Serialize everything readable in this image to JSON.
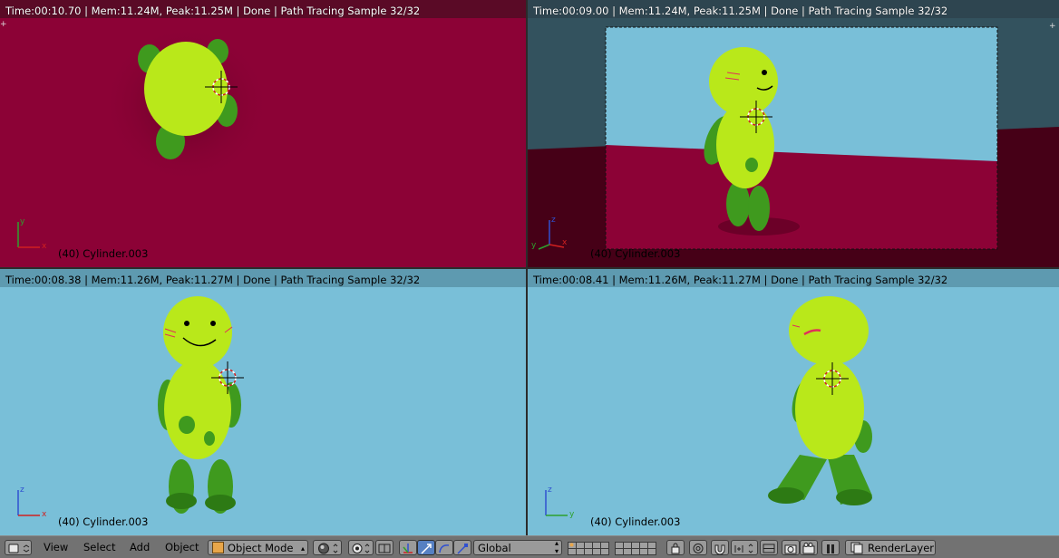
{
  "viewports": [
    {
      "id": "top-left",
      "render_info": "Time:00:10.70 | Mem:11.24M, Peak:11.25M | Done | Path Tracing Sample 32/32",
      "object_name": "(40) Cylinder.003",
      "axes": [
        "y",
        "x"
      ]
    },
    {
      "id": "top-right",
      "render_info": "Time:00:09.00 | Mem:11.24M, Peak:11.25M | Done | Path Tracing Sample 32/32",
      "object_name": "(40) Cylinder.003",
      "axes": [
        "z",
        "y",
        "x"
      ]
    },
    {
      "id": "bottom-left",
      "render_info": "Time:00:08.38 | Mem:11.26M, Peak:11.27M | Done | Path Tracing Sample 32/32",
      "object_name": "(40) Cylinder.003",
      "axes": [
        "z",
        "x"
      ]
    },
    {
      "id": "bottom-right",
      "render_info": "Time:00:08.41 | Mem:11.26M, Peak:11.27M | Done | Path Tracing Sample 32/32",
      "object_name": "(40) Cylinder.003",
      "axes": [
        "z",
        "y"
      ]
    }
  ],
  "header": {
    "menu": [
      "View",
      "Select",
      "Add",
      "Object"
    ],
    "mode": "Object Mode",
    "orientation": "Global",
    "render_layer": "RenderLayer"
  },
  "colors": {
    "floor": "#8c0236",
    "sky": "#79bfd8",
    "body": "#b9e81a",
    "limbs": "#3f9a1e"
  },
  "icons": [
    "editor-type-icon",
    "object-mode-icon",
    "viewport-shading-icon",
    "pivot-icon",
    "snap-icon",
    "manipulator-icon",
    "translate-icon",
    "rotate-icon",
    "scale-icon",
    "layers-icon",
    "proportional-edit-icon",
    "snap-magnet-icon",
    "render-icon",
    "anim-icon",
    "play-icon",
    "pause-icon",
    "render-layer-icon"
  ]
}
